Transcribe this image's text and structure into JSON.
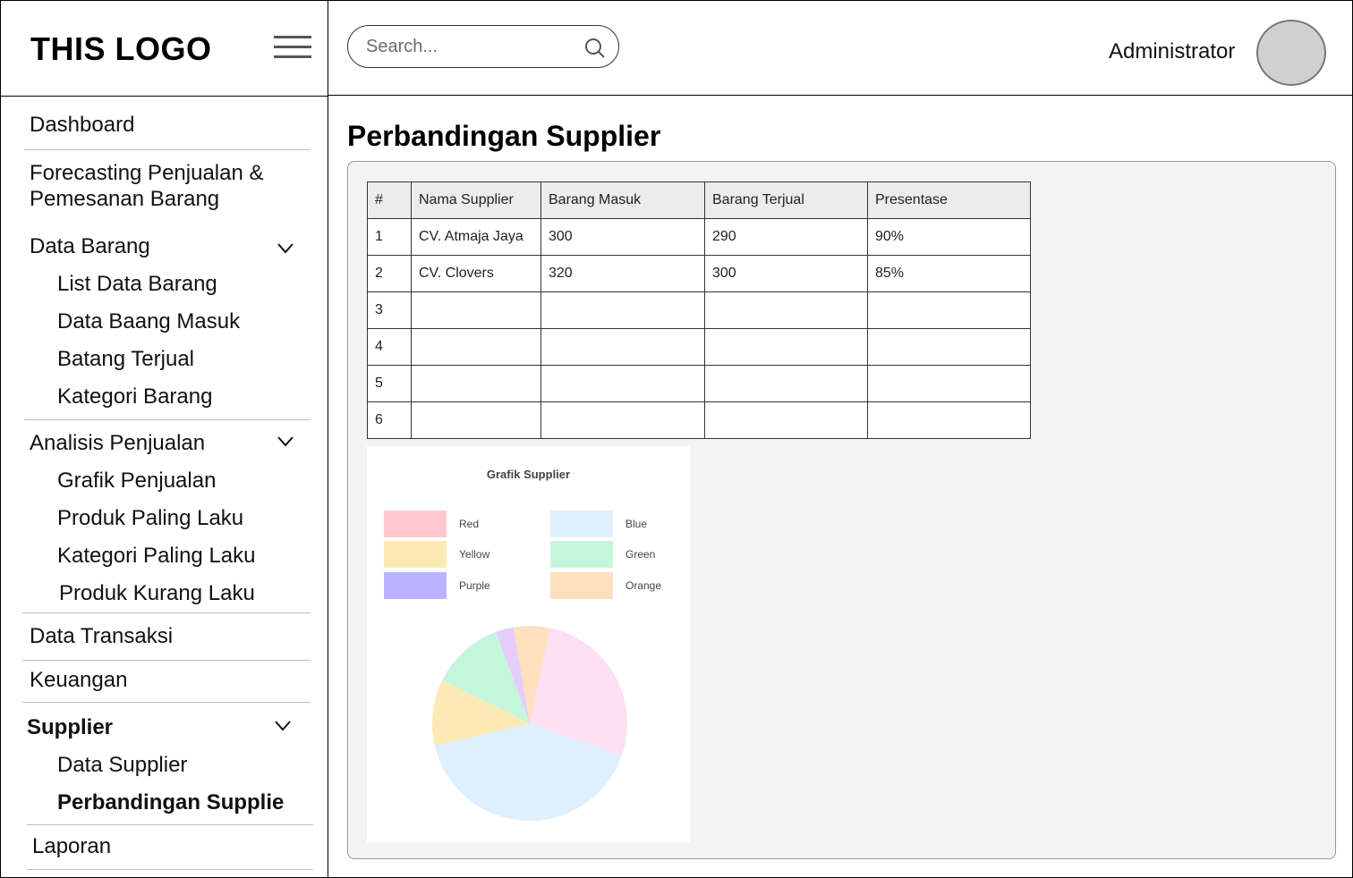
{
  "sidebar": {
    "logo": "THIS LOGO",
    "items": [
      {
        "label": "Dashboard"
      },
      {
        "label": "Forecasting Penjualan &"
      },
      {
        "label": "Pemesanan Barang"
      },
      {
        "label": "Data Barang"
      },
      {
        "label": "List Data Barang"
      },
      {
        "label": "Data Baang Masuk"
      },
      {
        "label": "Batang Terjual"
      },
      {
        "label": "Kategori Barang"
      },
      {
        "label": "Analisis Penjualan"
      },
      {
        "label": "Grafik Penjualan"
      },
      {
        "label": "Produk Paling Laku"
      },
      {
        "label": "Kategori Paling Laku"
      },
      {
        "label": "Produk Kurang Laku"
      },
      {
        "label": "Data Transaksi"
      },
      {
        "label": "Keuangan"
      },
      {
        "label": "Supplier"
      },
      {
        "label": "Data Supplier"
      },
      {
        "label": "Perbandingan Supplie"
      },
      {
        "label": "Laporan"
      }
    ]
  },
  "header": {
    "search_placeholder": "Search...",
    "user_name": "Administrator"
  },
  "main": {
    "title": "Perbandingan Supplier",
    "table": {
      "headers": [
        "#",
        "Nama Supplier",
        "Barang Masuk",
        "Barang Terjual",
        "Presentase"
      ],
      "rows": [
        [
          "1",
          "CV. Atmaja Jaya",
          "300",
          "290",
          "90%"
        ],
        [
          "2",
          "CV. Clovers",
          "320",
          "300",
          "85%"
        ],
        [
          "3",
          "",
          "",
          "",
          ""
        ],
        [
          "4",
          "",
          "",
          "",
          ""
        ],
        [
          "5",
          "",
          "",
          "",
          ""
        ],
        [
          "6",
          "",
          "",
          "",
          ""
        ]
      ]
    }
  },
  "chart_data": {
    "type": "pie",
    "title": "Grafik Supplier",
    "legend": [
      {
        "name": "Red",
        "color": "#ffc9cf"
      },
      {
        "name": "Blue",
        "color": "#dfeffe"
      },
      {
        "name": "Yellow",
        "color": "#fde9b3"
      },
      {
        "name": "Green",
        "color": "#c4f6dc"
      },
      {
        "name": "Purple",
        "color": "#bbb3ff"
      },
      {
        "name": "Orange",
        "color": "#fee0bf"
      }
    ],
    "slices": [
      {
        "value": 27,
        "color": "#fde0f3"
      },
      {
        "value": 41,
        "color": "#dfeffe"
      },
      {
        "value": 11,
        "color": "#fde9b3"
      },
      {
        "value": 12,
        "color": "#c4f6dc"
      },
      {
        "value": 3,
        "color": "#e4cdfb"
      },
      {
        "value": 6,
        "color": "#fee0bf"
      }
    ]
  }
}
